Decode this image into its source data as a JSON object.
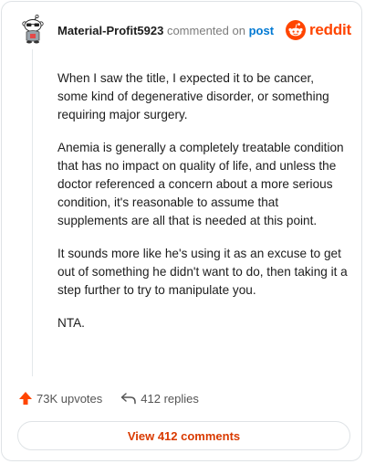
{
  "comment": {
    "author": "Material-Profit5923",
    "action_text": "commented on",
    "post_link_label": "post",
    "paragraphs": [
      "When I saw the title, I expected it to be cancer, some kind of degenerative disorder, or something requiring major surgery.",
      "Anemia is generally a completely treatable condition that has no impact on quality of life, and unless the doctor referenced a concern about a more serious condition, it's reasonable to assume that supplements are all that is needed at this point.",
      "It sounds more like he's using it as an excuse to get out of something he didn't want to do, then taking it a step further to try to manipulate you.",
      "NTA."
    ]
  },
  "brand": {
    "wordmark": "reddit",
    "color": "#ff4500"
  },
  "stats": {
    "upvotes_label": "73K upvotes",
    "replies_label": "412 replies"
  },
  "footer": {
    "view_comments_label": "View 412 comments"
  },
  "icons": {
    "avatar": "snoo-avatar-icon",
    "logo": "reddit-snoo-icon",
    "upvote": "upvote-arrow-icon",
    "reply": "reply-arrow-icon"
  }
}
